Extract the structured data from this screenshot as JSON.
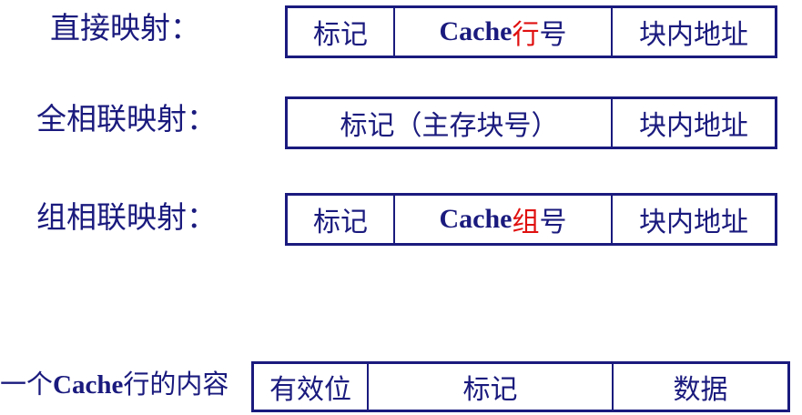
{
  "rows": [
    {
      "label": "直接映射：",
      "fields": [
        {
          "text": "标记"
        },
        {
          "prefix": "Cache",
          "highlight": "行",
          "suffix": "号"
        },
        {
          "text": "块内地址"
        }
      ]
    },
    {
      "label": "全相联映射：",
      "fields": [
        {
          "text": "标记（主存块号）"
        },
        {
          "text": "块内地址"
        }
      ]
    },
    {
      "label": "组相联映射：",
      "fields": [
        {
          "text": "标记"
        },
        {
          "prefix": "Cache",
          "highlight": "组",
          "suffix": "号"
        },
        {
          "text": "块内地址"
        }
      ]
    }
  ],
  "cache_line": {
    "label_pre": "一个",
    "label_cache": "Cache",
    "label_post": "行的内容",
    "fields": [
      {
        "text": "有效位"
      },
      {
        "text": "标记"
      },
      {
        "text": "数据"
      }
    ]
  },
  "colors": {
    "primary": "#1a1a7e",
    "highlight": "#e01010"
  }
}
